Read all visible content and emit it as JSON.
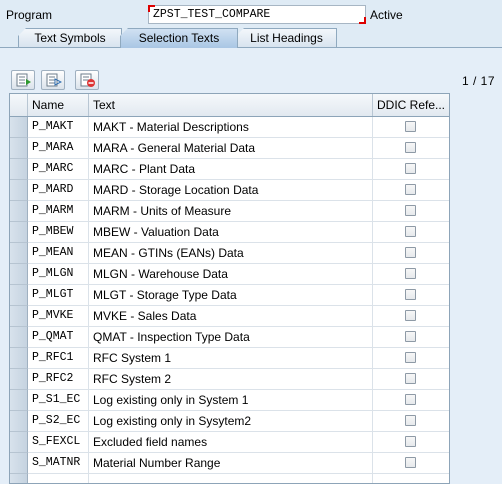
{
  "program": {
    "label": "Program",
    "value": "ZPST_TEST_COMPARE",
    "status": "Active"
  },
  "tabs": [
    {
      "label": "Text Symbols",
      "active": false
    },
    {
      "label": "Selection Texts",
      "active": true
    },
    {
      "label": "List Headings",
      "active": false
    }
  ],
  "toolbar": {
    "buttons": [
      "insert-row-icon",
      "copy-row-icon",
      "delete-row-icon"
    ]
  },
  "pager": "1  /  17",
  "table": {
    "headers": {
      "name": "Name",
      "text": "Text",
      "ddic": "DDIC Refe..."
    },
    "rows": [
      {
        "name": "P_MAKT",
        "text": "MAKT - Material Descriptions",
        "ddic": false
      },
      {
        "name": "P_MARA",
        "text": "MARA - General Material Data",
        "ddic": false
      },
      {
        "name": "P_MARC",
        "text": "MARC - Plant Data",
        "ddic": false
      },
      {
        "name": "P_MARD",
        "text": "MARD - Storage Location Data",
        "ddic": false
      },
      {
        "name": "P_MARM",
        "text": "MARM - Units of Measure",
        "ddic": false
      },
      {
        "name": "P_MBEW",
        "text": "MBEW - Valuation Data",
        "ddic": false
      },
      {
        "name": "P_MEAN",
        "text": "MEAN - GTINs (EANs) Data",
        "ddic": false
      },
      {
        "name": "P_MLGN",
        "text": "MLGN - Warehouse Data",
        "ddic": false
      },
      {
        "name": "P_MLGT",
        "text": "MLGT - Storage Type Data",
        "ddic": false
      },
      {
        "name": "P_MVKE",
        "text": "MVKE - Sales Data",
        "ddic": false
      },
      {
        "name": "P_QMAT",
        "text": "QMAT - Inspection Type Data",
        "ddic": false
      },
      {
        "name": "P_RFC1",
        "text": "RFC System 1",
        "ddic": false
      },
      {
        "name": "P_RFC2",
        "text": "RFC System 2",
        "ddic": false
      },
      {
        "name": "P_S1_EC",
        "text": "Log existing only in System 1",
        "ddic": false
      },
      {
        "name": "P_S2_EC",
        "text": "Log existing only in Sysytem2",
        "ddic": false
      },
      {
        "name": "S_FEXCL",
        "text": "Excluded field names",
        "ddic": false
      },
      {
        "name": "S_MATNR",
        "text": "Material Number Range",
        "ddic": false
      },
      {
        "name": "",
        "text": "",
        "ddic": null
      }
    ]
  }
}
